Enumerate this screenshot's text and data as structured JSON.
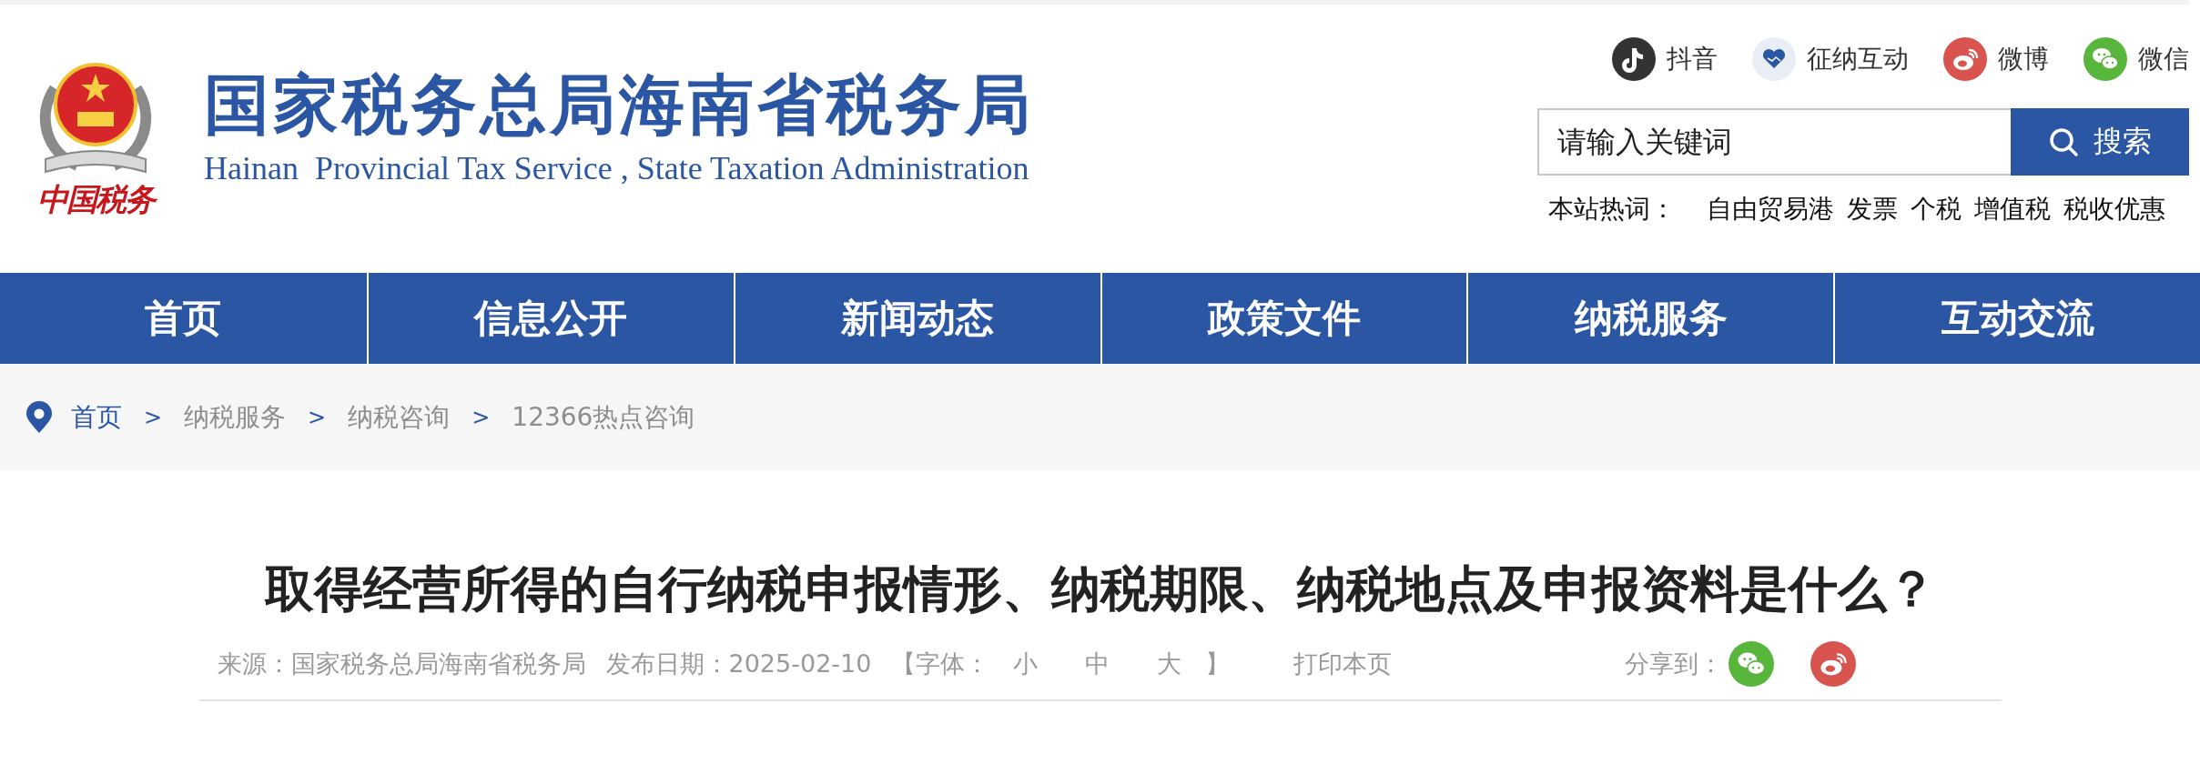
{
  "site": {
    "title_cn": "国家税务总局海南省税务局",
    "title_en": "Hainan  Provincial Tax Service , State Taxation Administration",
    "emblem_caption": "中国税务"
  },
  "social": [
    {
      "kind": "douyin",
      "label": "抖音"
    },
    {
      "kind": "interact",
      "label": "征纳互动"
    },
    {
      "kind": "weibo",
      "label": "微博"
    },
    {
      "kind": "wechat",
      "label": "微信"
    }
  ],
  "search": {
    "placeholder": "请输入关键词",
    "button": "搜索"
  },
  "hot_words": {
    "label": "本站热词：",
    "items": [
      "自由贸易港",
      "发票",
      "个税",
      "增值税",
      "税收优惠"
    ]
  },
  "nav": [
    "首页",
    "信息公开",
    "新闻动态",
    "政策文件",
    "纳税服务",
    "互动交流"
  ],
  "breadcrumb": [
    {
      "label": "首页",
      "kind": "home"
    },
    {
      "label": "纳税服务",
      "kind": "link"
    },
    {
      "label": "纳税咨询",
      "kind": "link"
    },
    {
      "label": "12366热点咨询",
      "kind": "link"
    }
  ],
  "breadcrumb_separator": ">",
  "article": {
    "title": "取得经营所得的自行纳税申报情形、纳税期限、纳税地点及申报资料是什么？",
    "source": "来源：国家税务总局海南省税务局",
    "date": "发布日期：2025-02-10",
    "font_open": "【字体：",
    "font_sizes": [
      "小",
      "中",
      "大"
    ],
    "font_close": "】",
    "print": "打印本页",
    "share_label": "分享到：",
    "share": [
      {
        "kind": "wechat"
      },
      {
        "kind": "weibo"
      }
    ]
  }
}
